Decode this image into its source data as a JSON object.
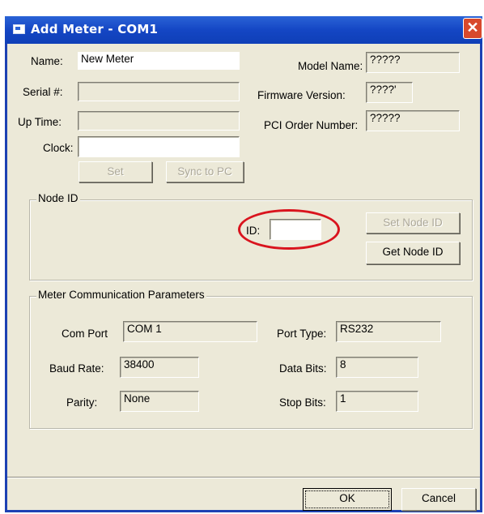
{
  "window": {
    "title": "Add Meter - COM1",
    "close_glyph": "✕"
  },
  "meter": {
    "name_label": "Name:",
    "name_value": "New Meter",
    "serial_label": "Serial #:",
    "serial_value": "",
    "uptime_label": "Up Time:",
    "uptime_value": "",
    "clock_label": "Clock:",
    "clock_value": "",
    "model_label": "Model Name:",
    "model_value": "?????",
    "firmware_label": "Firmware Version:",
    "firmware_value": "????'",
    "pci_label": "PCI Order Number:",
    "pci_value": "?????",
    "set_button": "Set",
    "sync_button": "Sync to PC"
  },
  "node_id": {
    "group_title": "Node ID",
    "id_label": "ID:",
    "id_value": "",
    "set_node_button": "Set Node ID",
    "get_node_button": "Get Node ID"
  },
  "comm": {
    "group_title": "Meter Communication Parameters",
    "com_port_label": "Com Port",
    "com_port_value": "COM 1",
    "port_type_label": "Port Type:",
    "port_type_value": "RS232",
    "baud_label": "Baud Rate:",
    "baud_value": "38400",
    "data_bits_label": "Data Bits:",
    "data_bits_value": "8",
    "parity_label": "Parity:",
    "parity_value": "None",
    "stop_bits_label": "Stop Bits:",
    "stop_bits_value": "1"
  },
  "footer": {
    "ok_button": "OK",
    "cancel_button": "Cancel"
  },
  "colors": {
    "titlebar": "#1446c4",
    "dialog_bg": "#ece9d8",
    "highlight_oval": "#d9141e"
  },
  "icons": {
    "app": "window-app-icon",
    "close": "close-icon"
  }
}
